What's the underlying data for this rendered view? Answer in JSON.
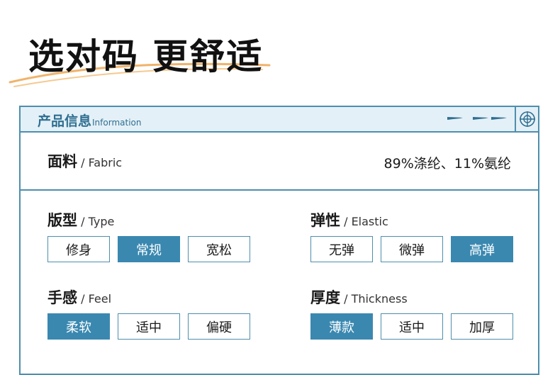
{
  "hero": {
    "title": "选对码 更舒适"
  },
  "info": {
    "title_zh": "产品信息",
    "title_en": "Information"
  },
  "fabric": {
    "label_zh": "面料",
    "label_en": "/ Fabric",
    "value": "89%涤纶、11%氨纶"
  },
  "type": {
    "label_zh": "版型",
    "label_en": "/ Type",
    "options": [
      "修身",
      "常规",
      "宽松"
    ],
    "selected": "常规"
  },
  "elastic": {
    "label_zh": "弹性",
    "label_en": "/ Elastic",
    "options": [
      "无弹",
      "微弹",
      "高弹"
    ],
    "selected": "高弹"
  },
  "feel": {
    "label_zh": "手感",
    "label_en": "/ Feel",
    "options": [
      "柔软",
      "适中",
      "偏硬"
    ],
    "selected": "柔软"
  },
  "thickness": {
    "label_zh": "厚度",
    "label_en": "/ Thickness",
    "options": [
      "薄款",
      "适中",
      "加厚"
    ],
    "selected": "薄款"
  },
  "colors": {
    "accent": "#3a88b0",
    "border": "#4d8fad",
    "header_bg": "#e4f0f7",
    "swoosh": "#f0b36a"
  },
  "icons": {
    "arrows": "arrow-right-icon",
    "target": "crosshair-icon"
  }
}
